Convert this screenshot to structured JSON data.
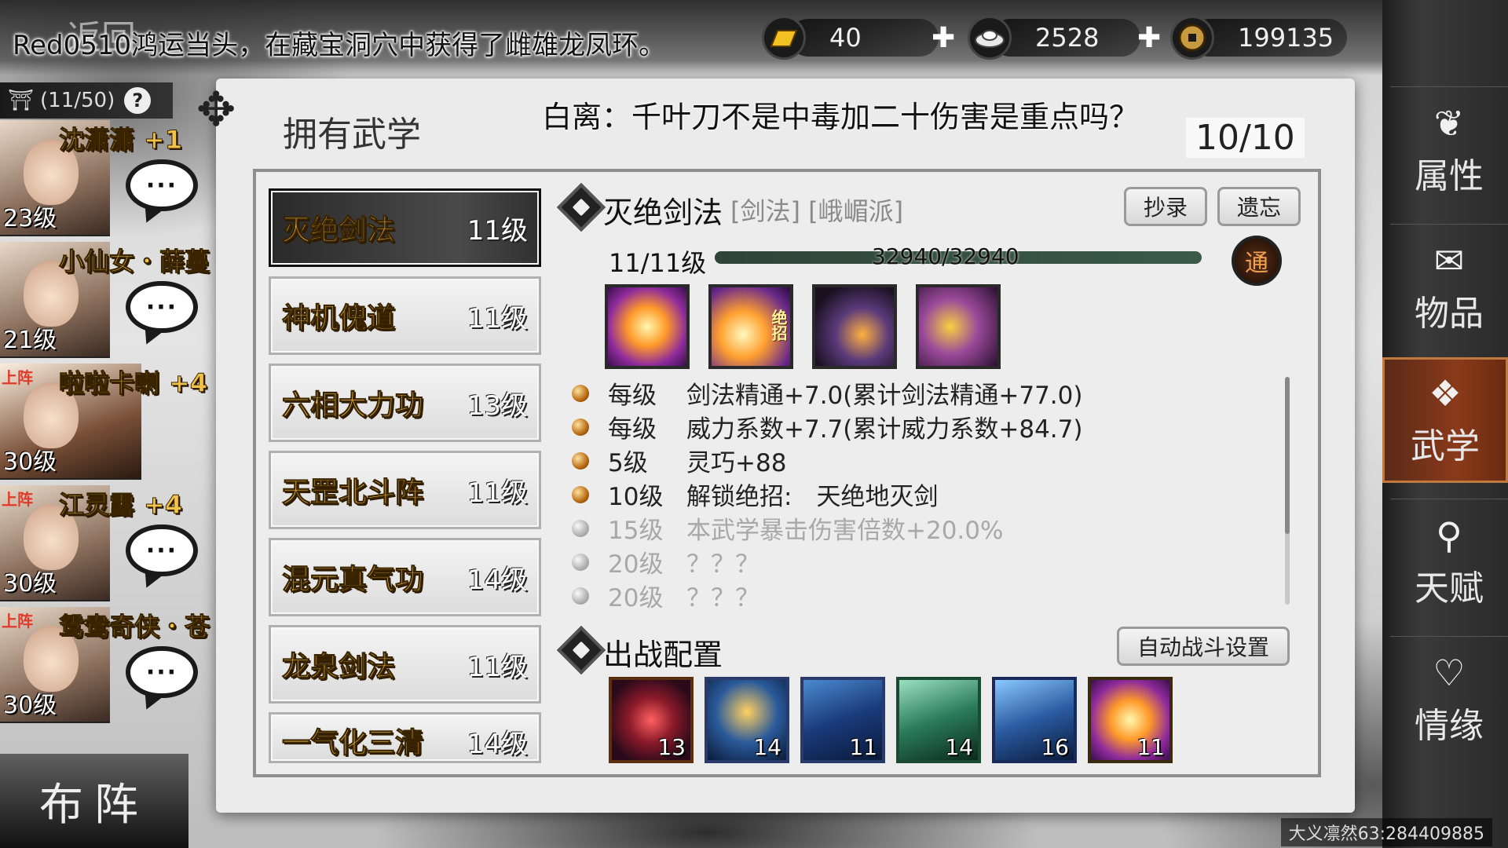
{
  "top": {
    "back_label": "返回",
    "notice": "Red0510鸿运当头，在藏宝洞穴中获得了雌雄龙凤环。",
    "currency": {
      "gold": "40",
      "silver": "2528",
      "coin": "199135"
    }
  },
  "roster": {
    "count": "(11/50)",
    "help": "?",
    "members": [
      {
        "name": "沈潇潇",
        "bonus": "+1",
        "level": "23级",
        "on": ""
      },
      {
        "name": "小仙女・薛蔓",
        "bonus": "",
        "level": "21级",
        "on": ""
      },
      {
        "name": "啦啦卡喇",
        "bonus": "+4",
        "level": "30级",
        "on": "上阵"
      },
      {
        "name": "江灵露",
        "bonus": "+4",
        "level": "30级",
        "on": "上阵"
      },
      {
        "name": "鸳鸯奇侠・苍",
        "bonus": "",
        "level": "30级",
        "on": "上阵"
      }
    ],
    "chat_label": "···",
    "formation": "布阵"
  },
  "panel": {
    "title": "拥有武学",
    "npc_line": "白离：千叶刀不是中毒加二十伤害是重点吗？",
    "count": "10/10",
    "skills": [
      {
        "name": "灭绝剑法",
        "level": "11级"
      },
      {
        "name": "神机傀道",
        "level": "11级"
      },
      {
        "name": "六相大力功",
        "level": "13级"
      },
      {
        "name": "天罡北斗阵",
        "level": "11级"
      },
      {
        "name": "混元真气功",
        "level": "14级"
      },
      {
        "name": "龙泉剑法",
        "level": "11级"
      },
      {
        "name": "一气化三清",
        "level": "14级"
      }
    ]
  },
  "detail": {
    "name": "灭绝剑法",
    "tags": "[剑法] [峨嵋派]",
    "copy_btn": "抄录",
    "forget_btn": "遗忘",
    "level": "11/11级",
    "exp": "32940/32940",
    "exp_fraction": 1.0,
    "tong": "通",
    "ultimate_tag": "绝招",
    "effects": [
      {
        "lvl": "每级",
        "desc": "剑法精通+7.0(累计剑法精通+77.0)",
        "unlocked": true
      },
      {
        "lvl": "每级",
        "desc": "威力系数+7.7(累计威力系数+84.7)",
        "unlocked": true
      },
      {
        "lvl": "5级",
        "desc": "灵巧+88",
        "unlocked": true
      },
      {
        "lvl": "10级",
        "desc": "解锁绝招:　天绝地灭剑",
        "unlocked": true
      },
      {
        "lvl": "15级",
        "desc": "本武学暴击伤害倍数+20.0%",
        "unlocked": false
      },
      {
        "lvl": "20级",
        "desc": "？？？",
        "unlocked": false
      },
      {
        "lvl": "20级",
        "desc": "？？？",
        "unlocked": false
      }
    ]
  },
  "battle": {
    "title": "出战配置",
    "auto_btn": "自动战斗设置",
    "slots": [
      "13",
      "14",
      "11",
      "14",
      "16",
      "11"
    ]
  },
  "nav": [
    {
      "label": "属性",
      "icon": "❦"
    },
    {
      "label": "物品",
      "icon": "✉"
    },
    {
      "label": "武学",
      "icon": "❖"
    },
    {
      "label": "天赋",
      "icon": "⚲"
    },
    {
      "label": "情缘",
      "icon": "♡"
    }
  ],
  "watermark": "大义凛然63:284409885"
}
